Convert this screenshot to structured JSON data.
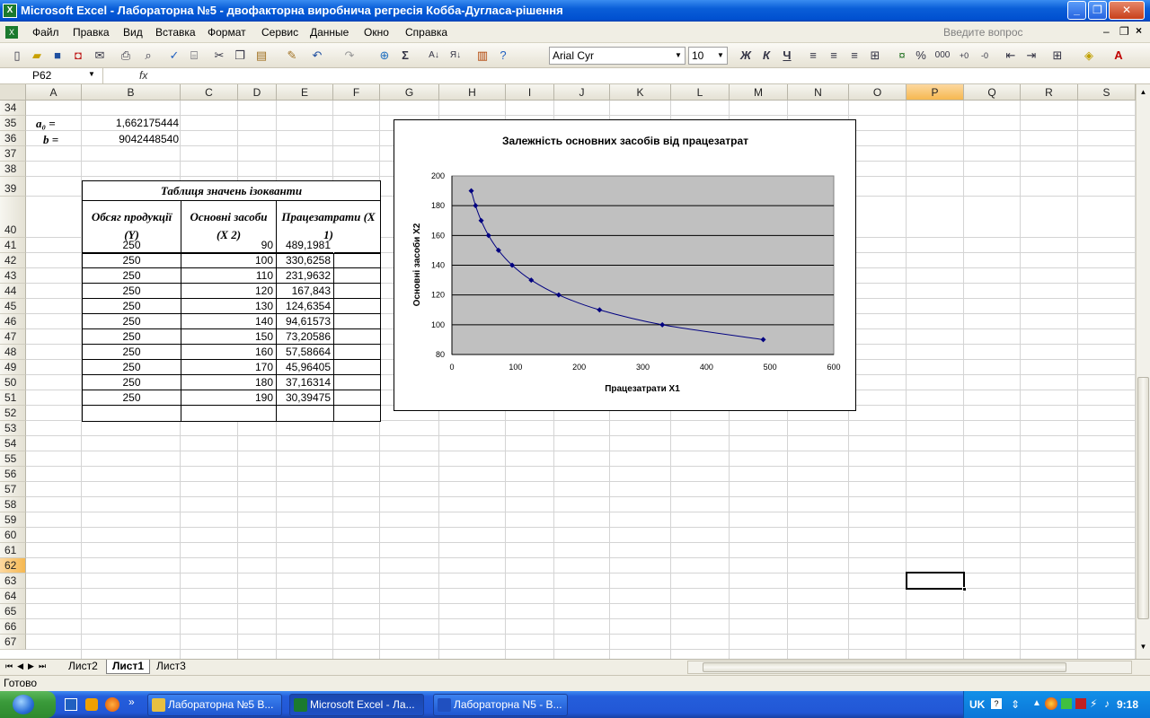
{
  "window": {
    "title": "Microsoft Excel - Лабораторна №5 - двофакторна виробнича регресія Кобба-Дугласа-рішення"
  },
  "menu": [
    "Файл",
    "Правка",
    "Вид",
    "Вставка",
    "Формат",
    "Сервис",
    "Данные",
    "Окно",
    "Справка"
  ],
  "help_placeholder": "Введите вопрос",
  "toolbar": {
    "font": "Arial Cyr",
    "size": "10",
    "bold": "Ж",
    "italic": "К",
    "underline": "Ч",
    "percent": "%",
    "thousands": "000"
  },
  "namebox": "P62",
  "fx": "fx",
  "columns": [
    "A",
    "B",
    "C",
    "D",
    "E",
    "F",
    "G",
    "H",
    "I",
    "J",
    "K",
    "L",
    "M",
    "N",
    "O",
    "P",
    "Q",
    "R",
    "S"
  ],
  "rows": [
    "34",
    "35",
    "36",
    "37",
    "38",
    "39",
    "40",
    "41",
    "42",
    "43",
    "44",
    "45",
    "46",
    "47",
    "48",
    "49",
    "50",
    "51",
    "52",
    "53",
    "54",
    "55",
    "56",
    "57",
    "58",
    "59",
    "60",
    "61",
    "62",
    "63",
    "64",
    "65",
    "66",
    "67"
  ],
  "params": {
    "a0_label": "a₀  =",
    "a0_value": "1,662175444",
    "b_label": "b  =",
    "b_value": "9042448540"
  },
  "table": {
    "title": "Таблиця значень ізокванти",
    "headers": [
      "Обсяг продукції (Y)",
      "Основні засоби (X 2)",
      "Працезатрати (X 1)"
    ],
    "rows": [
      [
        "250",
        "90",
        "489,1981"
      ],
      [
        "250",
        "100",
        "330,6258"
      ],
      [
        "250",
        "110",
        "231,9632"
      ],
      [
        "250",
        "120",
        "167,843"
      ],
      [
        "250",
        "130",
        "124,6354"
      ],
      [
        "250",
        "140",
        "94,61573"
      ],
      [
        "250",
        "150",
        "73,20586"
      ],
      [
        "250",
        "160",
        "57,58664"
      ],
      [
        "250",
        "170",
        "45,96405"
      ],
      [
        "250",
        "180",
        "37,16314"
      ],
      [
        "250",
        "190",
        "30,39475"
      ]
    ]
  },
  "chart_data": {
    "type": "scatter",
    "title": "Залежність основних засобів від працезатрат",
    "xlabel": "Працезатрати X1",
    "ylabel": "Основні засоби X2",
    "xlim": [
      0,
      600
    ],
    "ylim": [
      80,
      200
    ],
    "xticks": [
      0,
      100,
      200,
      300,
      400,
      500,
      600
    ],
    "yticks": [
      80,
      100,
      120,
      140,
      160,
      180,
      200
    ],
    "grid": true,
    "x": [
      489.1981,
      330.6258,
      231.9632,
      167.843,
      124.6354,
      94.61573,
      73.20586,
      57.58664,
      45.96405,
      37.16314,
      30.39475
    ],
    "y": [
      90,
      100,
      110,
      120,
      130,
      140,
      150,
      160,
      170,
      180,
      190
    ],
    "color": "#000080",
    "plot_bg": "#c0c0c0"
  },
  "sheets": [
    "Лист2",
    "Лист1",
    "Лист3"
  ],
  "active_sheet": "Лист1",
  "status": "Готово",
  "taskbar": {
    "items": [
      "Лабораторна №5 В...",
      "Microsoft Excel - Ла...",
      "Лабораторна N5 - В..."
    ],
    "lang": "UK",
    "clock": "9:18"
  }
}
